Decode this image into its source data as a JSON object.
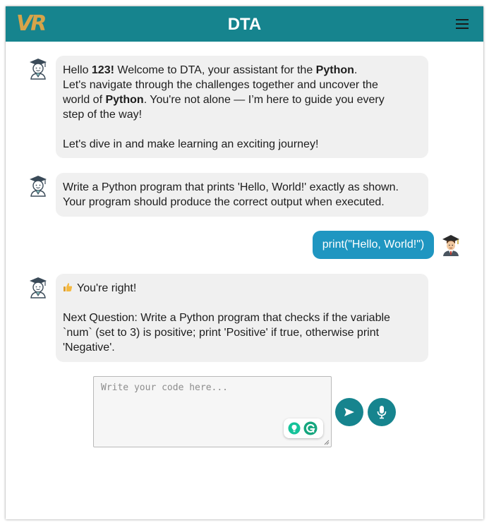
{
  "header": {
    "logo": "VR",
    "title": "DTA",
    "menu_icon": "hamburger-menu-icon"
  },
  "messages": [
    {
      "sender": "bot",
      "avatar_icon": "graduate-bot-icon",
      "parts": {
        "hello": "Hello ",
        "username": "123!",
        "welcome": " Welcome to DTA, your assistant for the ",
        "subject": "Python",
        "period": ".",
        "line2": "Let's navigate through the challenges together and uncover the",
        "line3a": "world of ",
        "subject2": "Python",
        "line3b": ". You're not alone — I’m here to guide you every",
        "line4": "step of the way!",
        "line5": "Let's dive in and make learning an exciting journey!"
      }
    },
    {
      "sender": "bot",
      "avatar_icon": "graduate-bot-icon",
      "lines": [
        "Write a Python program that prints 'Hello, World!' exactly as shown.",
        "Your program should produce the correct output when executed."
      ]
    },
    {
      "sender": "user",
      "avatar_icon": "graduate-student-icon",
      "text": "print(\"Hello, World!\")"
    },
    {
      "sender": "bot",
      "avatar_icon": "graduate-bot-icon",
      "feedback_icon": "thumbs-up-icon",
      "feedback": "You're right!",
      "lines": [
        "Next Question: Write a Python program that checks if the variable",
        "`num` (set to 3) is positive; print 'Positive' if true, otherwise print",
        "'Negative'."
      ]
    }
  ],
  "composer": {
    "placeholder": "Write your code here...",
    "value": "",
    "send_icon": "send-arrow-icon",
    "mic_icon": "microphone-icon",
    "grammarly_icons": [
      "lightbulb-suggestion-icon",
      "grammarly-g-icon"
    ]
  },
  "colors": {
    "header": "#16848e",
    "logo": "#d6a44a",
    "bot_bubble": "#f0f0f0",
    "user_bubble": "#1f96c1",
    "buttons": "#16848e"
  }
}
